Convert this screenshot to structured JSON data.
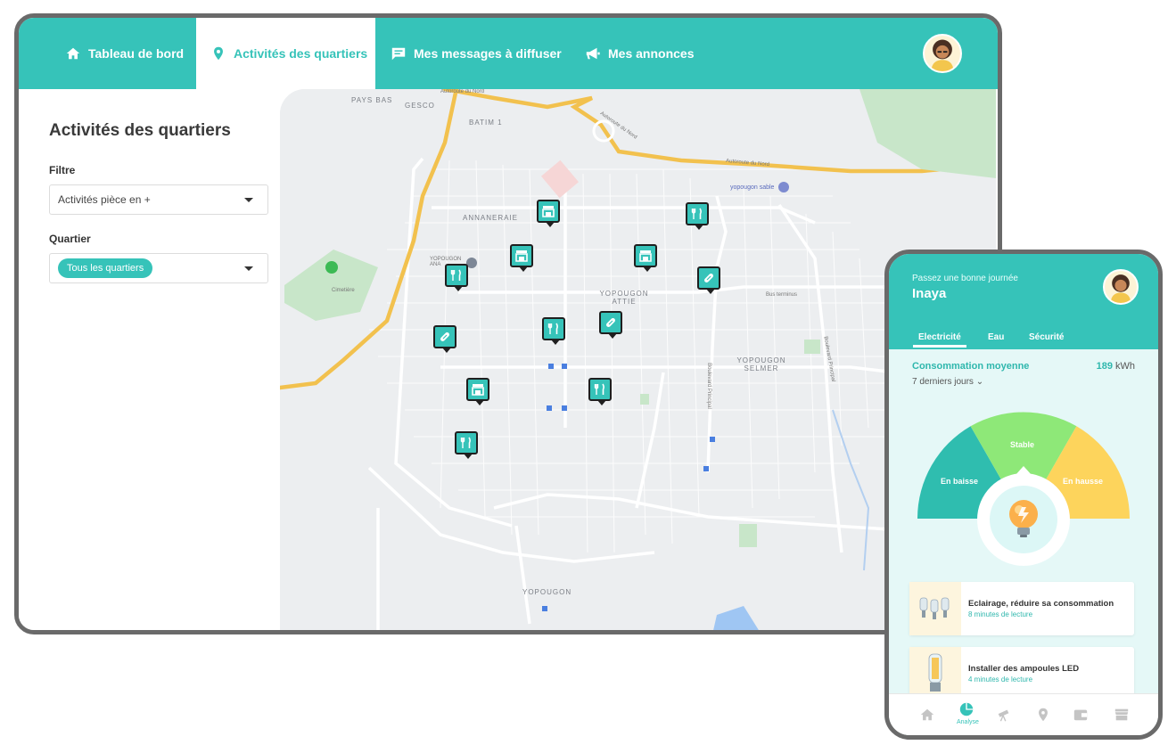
{
  "nav": {
    "items": [
      {
        "label": "Tableau de bord",
        "icon": "home-icon"
      },
      {
        "label": "Activités des quartiers",
        "icon": "map-pin-icon",
        "active": true
      },
      {
        "label": "Mes messages à diffuser",
        "icon": "message-icon"
      },
      {
        "label": "Mes annonces",
        "icon": "megaphone-icon"
      }
    ],
    "accent_color": "#36c3b9"
  },
  "sidebar": {
    "title": "Activités des quartiers",
    "filter_label": "Filtre",
    "filter_value": "Activités pièce en +",
    "quartier_label": "Quartier",
    "quartier_value": "Tous les quartiers"
  },
  "map": {
    "labels": [
      "PAYS BAS",
      "GESCO",
      "BATIM 1",
      "ANNANERAIE",
      "YOPOUGON ATTIE",
      "YOPOUGON SELMER",
      "YOPOUGON",
      "Cimetière",
      "yopougon sable",
      "YOPOUGON ANA"
    ],
    "roads": [
      "Autoroute du Nord",
      "Autoroute du Nord",
      "Autoroute du Nord",
      "Boulevard Principal",
      "Boulevard Principal",
      "Bus terminus"
    ],
    "pins": [
      "shop",
      "dining",
      "shop",
      "shop",
      "dining",
      "pharmacy",
      "dining",
      "pharmacy",
      "pharmacy",
      "shop",
      "dining",
      "dining"
    ]
  },
  "phone": {
    "greeting": "Passez une bonne journée",
    "name": "Inaya",
    "tabs": [
      "Electricité",
      "Eau",
      "Sécurité"
    ],
    "consumption_label": "Consommation moyenne",
    "consumption_value": "189",
    "consumption_unit": "kWh",
    "period": "7 derniers jours",
    "gauge": {
      "low": "En baisse",
      "mid": "Stable",
      "high": "En hausse",
      "colors": {
        "low": "#2fbdaf",
        "mid": "#8ee878",
        "high": "#fdd45c"
      }
    },
    "cards": [
      {
        "title": "Eclairage, réduire sa consommation",
        "subtitle": "8 minutes de lecture"
      },
      {
        "title": "Installer des ampoules LED",
        "subtitle": "4 minutes de lecture"
      }
    ],
    "bottom_nav": {
      "active_label": "Analyse"
    }
  }
}
